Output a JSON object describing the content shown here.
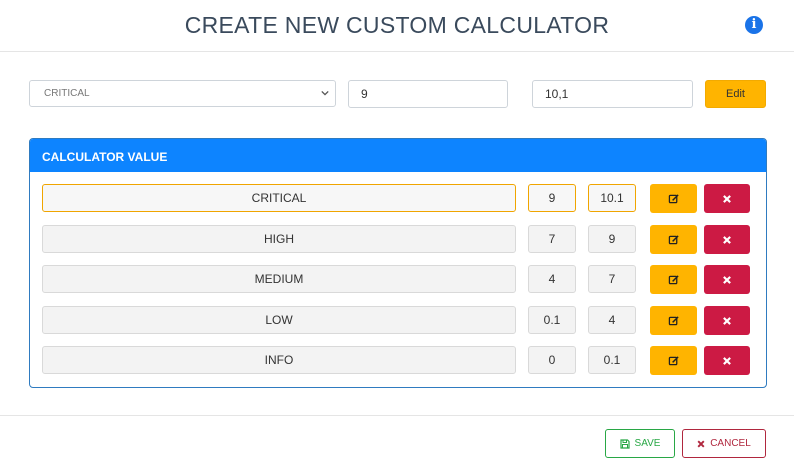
{
  "header": {
    "title": "CREATE NEW CUSTOM CALCULATOR",
    "info_icon": "i"
  },
  "form": {
    "level_select": {
      "selected": "CRITICAL"
    },
    "min_input": {
      "value": "9"
    },
    "max_input": {
      "value": "10,1"
    },
    "edit_label": "Edit"
  },
  "calculator": {
    "title": "CALCULATOR VALUE",
    "rows": [
      {
        "name": "CRITICAL",
        "min": "9",
        "max": "10.1",
        "active": true
      },
      {
        "name": "HIGH",
        "min": "7",
        "max": "9",
        "active": false
      },
      {
        "name": "MEDIUM",
        "min": "4",
        "max": "7",
        "active": false
      },
      {
        "name": "LOW",
        "min": "0.1",
        "max": "4",
        "active": false
      },
      {
        "name": "INFO",
        "min": "0",
        "max": "0.1",
        "active": false
      }
    ]
  },
  "footer": {
    "save_label": "SAVE",
    "cancel_label": "CANCEL"
  },
  "icons": {
    "info": "info-icon",
    "chevron": "chevron-down-icon",
    "edit": "edit-icon",
    "delete": "close-icon",
    "save": "floppy-disk-icon",
    "cancel": "close-icon"
  },
  "colors": {
    "primary": "#0d84ff",
    "warning": "#ffb400",
    "danger": "#cc1a44",
    "success": "#28a745"
  }
}
